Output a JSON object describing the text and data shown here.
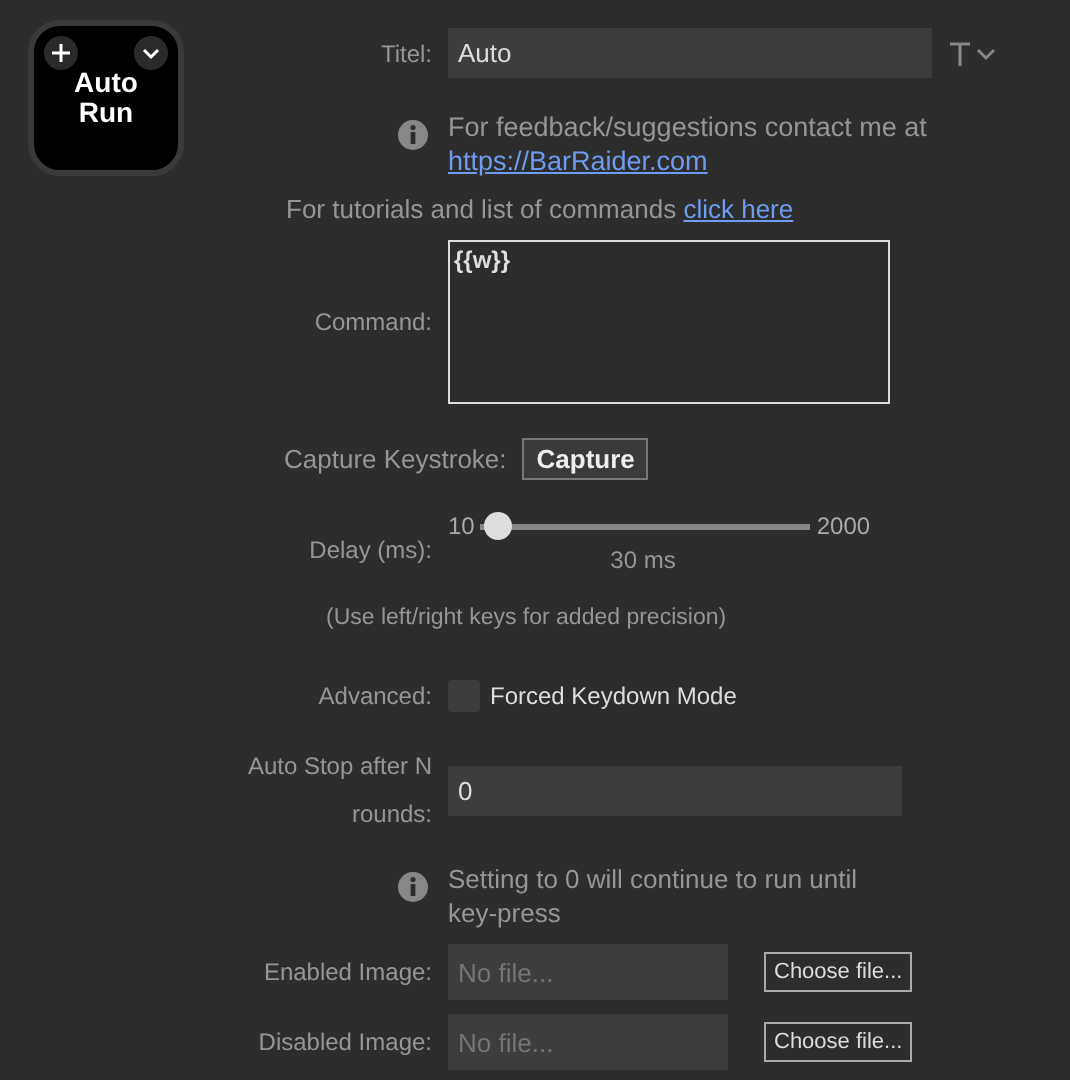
{
  "key_tile": {
    "title": "Auto\nRun"
  },
  "title_field": {
    "label": "Titel:",
    "value": "Auto"
  },
  "feedback": {
    "text": "For feedback/suggestions contact me at",
    "link": "https://BarRaider.com"
  },
  "tutorials": {
    "text": "For tutorials and list of commands",
    "link": "click here"
  },
  "command": {
    "label": "Command:",
    "value": "{{w}}"
  },
  "capture": {
    "label": "Capture Keystroke:",
    "button": "Capture"
  },
  "delay": {
    "label": "Delay (ms):",
    "min": "10",
    "max": "2000",
    "level": 0.05,
    "reading": "30 ms",
    "hint": "(Use left/right keys for added precision)"
  },
  "advanced": {
    "label": "Advanced:",
    "option": "Forced Keydown Mode",
    "checked": false
  },
  "auto_stop": {
    "label": "Auto Stop after N rounds:",
    "value": "0",
    "info": "Setting to 0 will continue to run until key-press"
  },
  "images": [
    {
      "label": "Enabled Image:",
      "placeholder": "No file...",
      "button": "Choose file..."
    },
    {
      "label": "Disabled Image:",
      "placeholder": "No file...",
      "button": "Choose file..."
    }
  ]
}
